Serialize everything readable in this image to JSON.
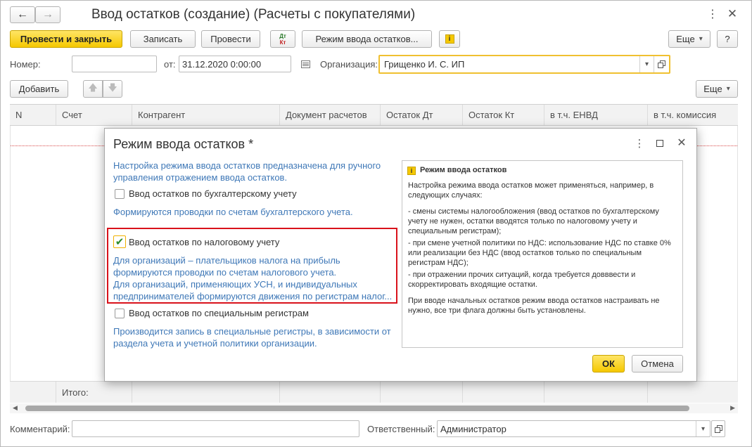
{
  "window": {
    "title": "Ввод остатков (создание) (Расчеты с покупателями)"
  },
  "toolbar": {
    "post_and_close": "Провести и закрыть",
    "save": "Записать",
    "post": "Провести",
    "dt_label": "Дт",
    "kt_label": "Кт",
    "balance_mode": "Режим ввода остатков...",
    "more": "Еще",
    "help": "?"
  },
  "header": {
    "number_label": "Номер:",
    "number_value": "",
    "date_label": "от:",
    "date_value": "31.12.2020  0:00:00",
    "org_label": "Организация:",
    "org_value": "Грищенко И. С. ИП"
  },
  "table_toolbar": {
    "add": "Добавить",
    "more": "Еще"
  },
  "table": {
    "columns": [
      "N",
      "Счет",
      "Контрагент",
      "Документ расчетов",
      "Остаток Дт",
      "Остаток Кт",
      "в т.ч. ЕНВД",
      "в т.ч. комиссия"
    ],
    "total_label": "Итого:"
  },
  "footer": {
    "comment_label": "Комментарий:",
    "comment_value": "",
    "responsible_label": "Ответственный:",
    "responsible_value": "Администратор"
  },
  "dialog": {
    "title": "Режим ввода остатков *",
    "intro": "Настройка режима ввода остатков предназначена для ручного управления отражением  ввода остатков.",
    "options": [
      {
        "label": "Ввод остатков по бухгалтерскому учету",
        "checked": false,
        "description": "Формируются проводки по счетам бухгалтерского учета."
      },
      {
        "label": "Ввод остатков по налоговому учету",
        "checked": true,
        "description_1": "Для организаций – плательщиков налога на прибыль формируются проводки по счетам налогового учета.",
        "description_2": "Для организаций, применяющих УСН, и  индивидуальных предпринимателей формируются движения по регистрам налог..."
      },
      {
        "label": "Ввод остатков по специальным регистрам",
        "checked": false,
        "description": "Производится запись в специальные регистры, в зависимости от раздела учета и учетной политики организации."
      }
    ],
    "help_title": "Режим ввода остатков",
    "help_paragraphs": [
      "Настройка режима ввода остатков может применяться, например, в следующих случаях:",
      "- смены системы налогообложения (ввод остатков по бухгалтерскому учету не нужен, остатки вводятся только по налоговому учету и специальным регистрам);",
      "- при смене учетной политики по НДС: использование НДС по ставке 0% или реализации без НДС (ввод остатков только по специальным регистрам НДС);",
      "- при отражении прочих ситуаций, когда требуется довввести и скорректировать входящие остатки.",
      "При вводе начальных остатков режим ввода остатков настраивать не нужно, все три флага должны быть установлены."
    ],
    "ok": "ОК",
    "cancel": "Отмена"
  },
  "colors": {
    "primary_button": "#f5c800",
    "highlight_frame": "#d9121b",
    "info_text": "#3f78b7",
    "focus_border": "#f0c030"
  }
}
